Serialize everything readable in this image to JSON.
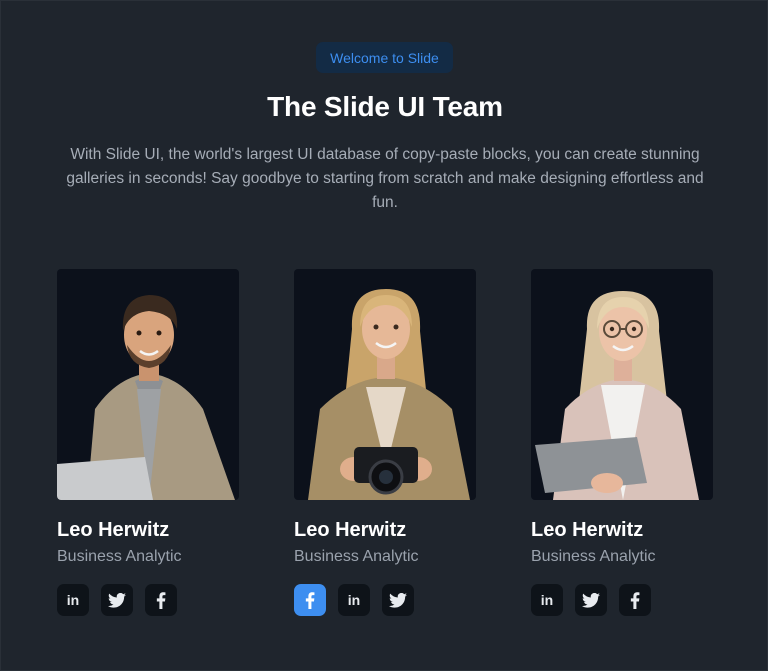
{
  "header": {
    "badge": "Welcome to Slide",
    "title": "The Slide UI Team",
    "subtitle": "With Slide UI, the world's largest UI database of copy-paste blocks, you can create stunning galleries in seconds! Say goodbye to starting from scratch and make designing effortless and fun."
  },
  "team": [
    {
      "name": "Leo Herwitz",
      "role": "Business Analytic",
      "socials": [
        "linkedin-icon",
        "twitter-icon",
        "facebook-icon"
      ]
    },
    {
      "name": "Leo Herwitz",
      "role": "Business Analytic",
      "socials": [
        "facebook-icon",
        "linkedin-icon",
        "twitter-icon"
      ],
      "active_social": "facebook-icon"
    },
    {
      "name": "Leo Herwitz",
      "role": "Business Analytic",
      "socials": [
        "linkedin-icon",
        "twitter-icon",
        "facebook-icon"
      ]
    }
  ],
  "colors": {
    "background": "#1f252d",
    "accent": "#3d8ef0",
    "photo_bg": "#0c111b",
    "icon_bg": "#0e1319"
  }
}
